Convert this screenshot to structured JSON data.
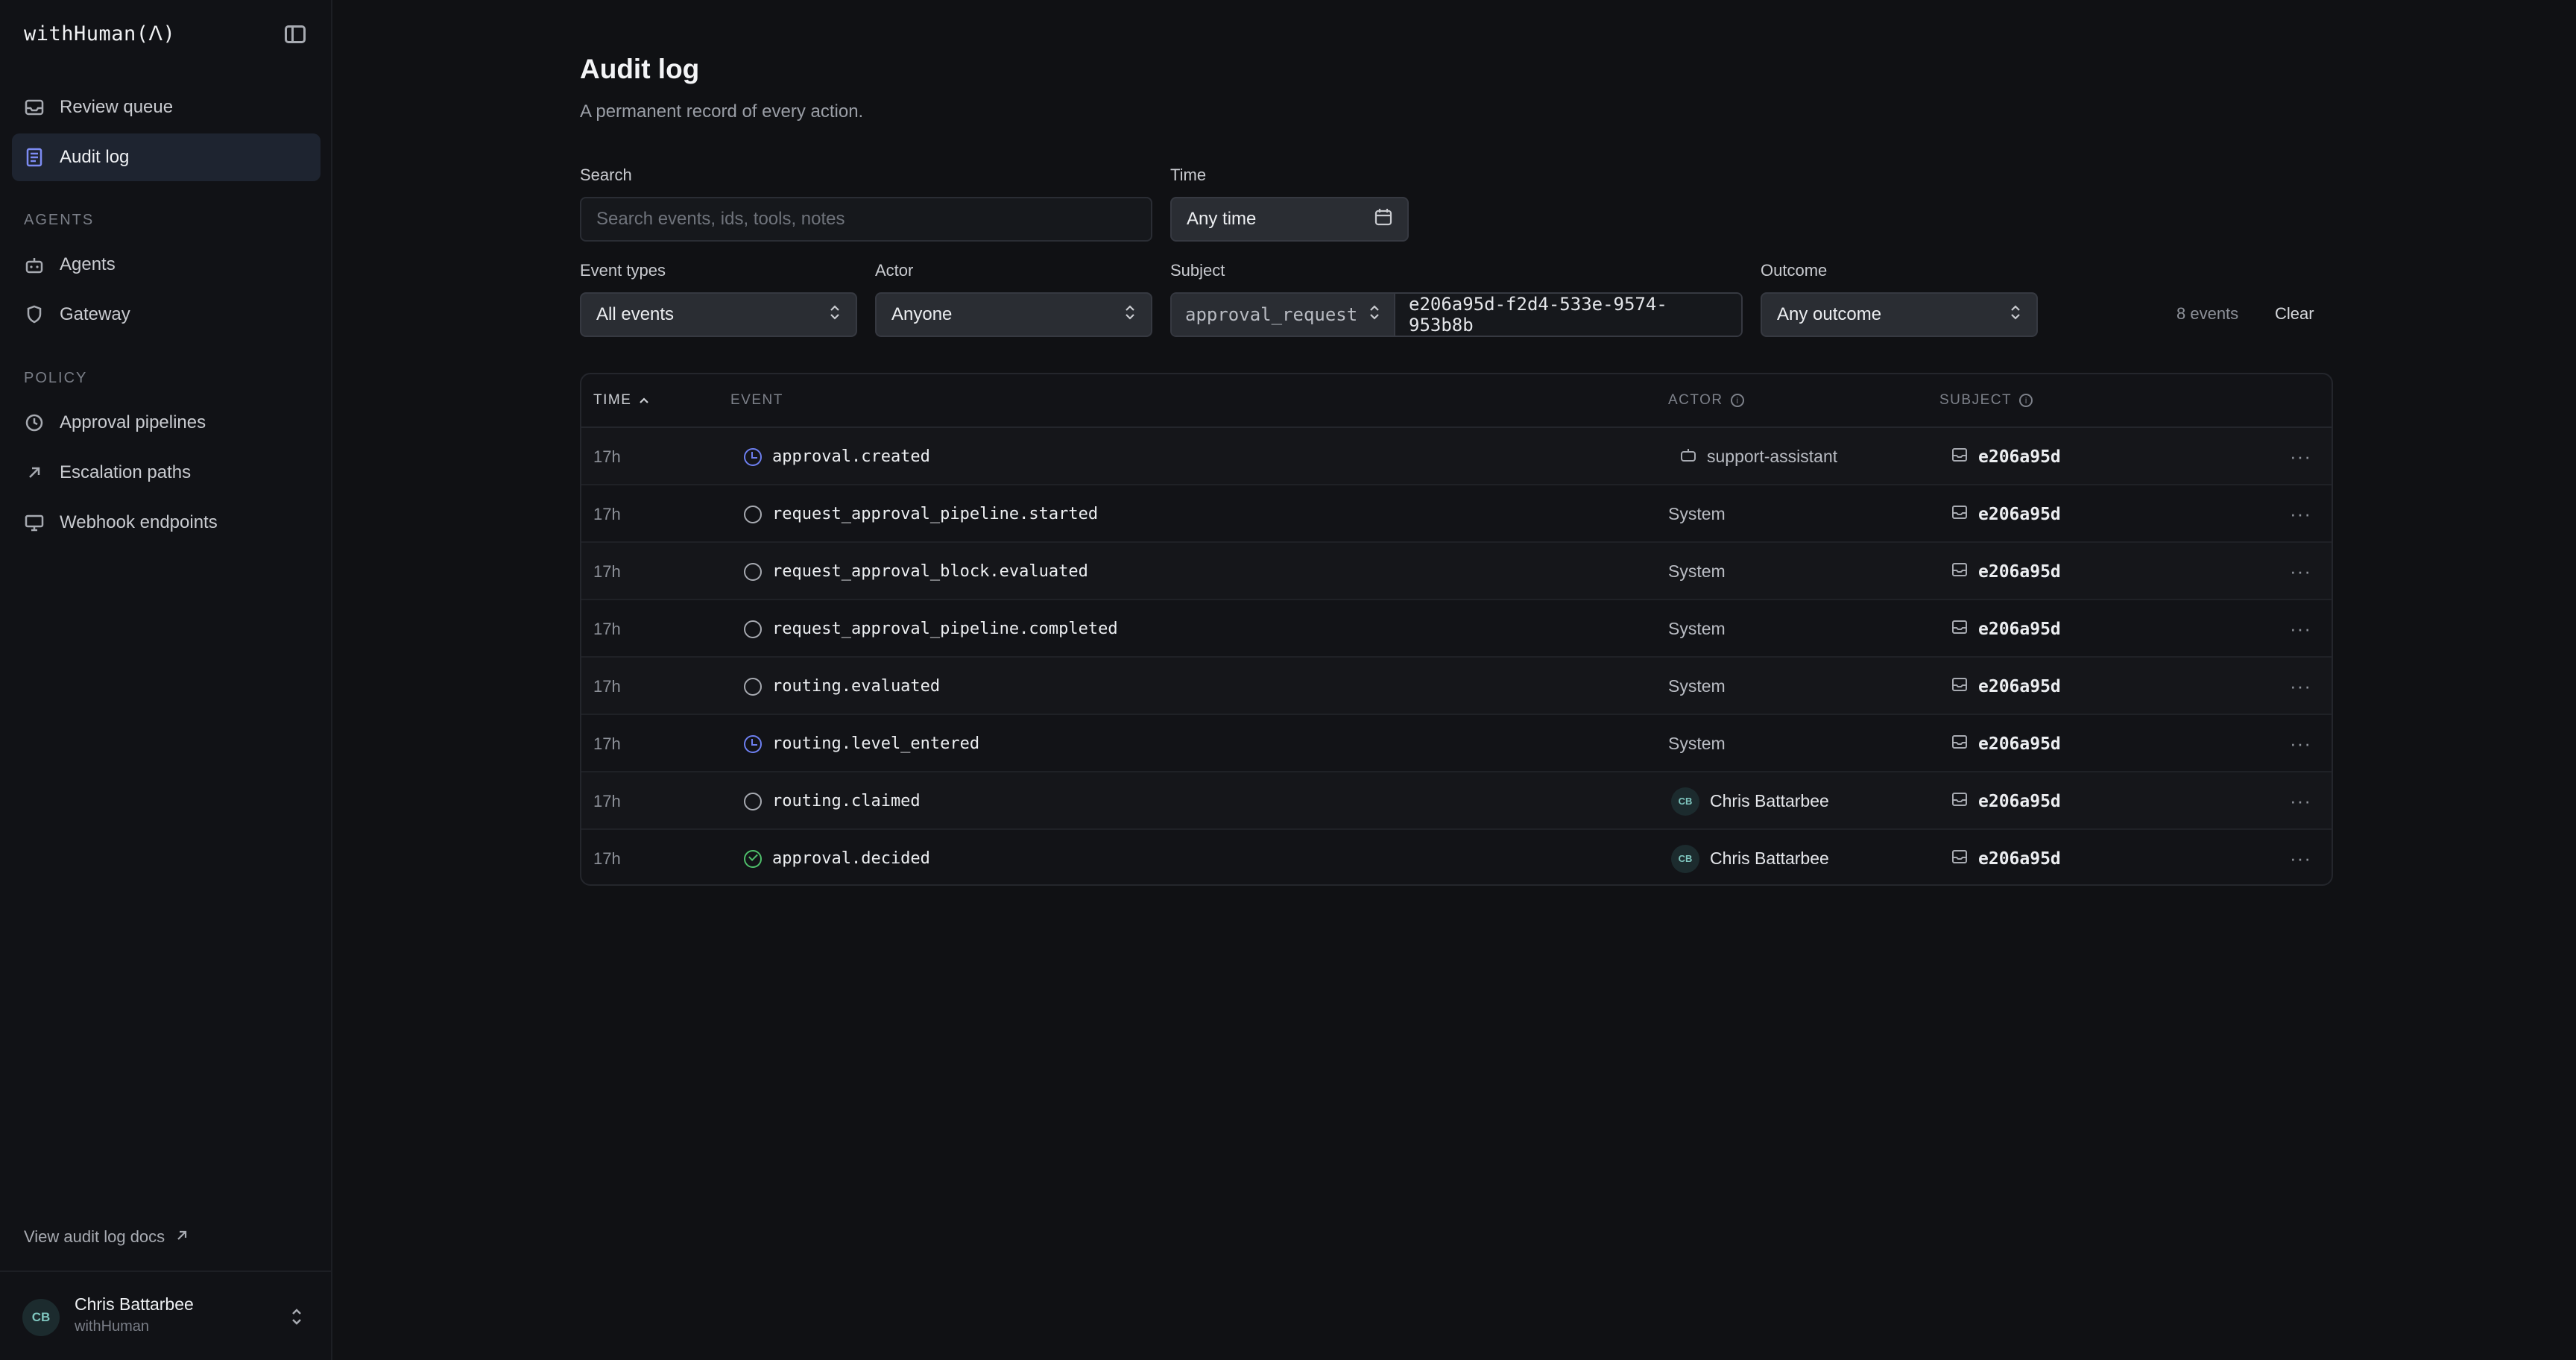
{
  "sidebar": {
    "brand": "withHuman(ᐱ)",
    "items": [
      {
        "label": "Review queue"
      },
      {
        "label": "Audit log"
      }
    ],
    "agents_section": "AGENTS",
    "agents_items": [
      {
        "label": "Agents"
      },
      {
        "label": "Gateway"
      }
    ],
    "policy_section": "POLICY",
    "policy_items": [
      {
        "label": "Approval pipelines"
      },
      {
        "label": "Escalation paths"
      },
      {
        "label": "Webhook endpoints"
      }
    ],
    "docs_link": "View audit log docs",
    "user": {
      "initials": "CB",
      "name": "Chris Battarbee",
      "org": "withHuman"
    }
  },
  "header": {
    "title": "Audit log",
    "subtitle": "A permanent record of every action."
  },
  "filters": {
    "search_label": "Search",
    "search_placeholder": "Search events, ids, tools, notes",
    "time_label": "Time",
    "time_value": "Any time",
    "event_types_label": "Event types",
    "event_types_value": "All events",
    "actor_label": "Actor",
    "actor_value": "Anyone",
    "subject_label": "Subject",
    "subject_type": "approval_request",
    "subject_id": "e206a95d-f2d4-533e-9574-953b8b",
    "outcome_label": "Outcome",
    "outcome_value": "Any outcome",
    "count": "8 events",
    "clear": "Clear"
  },
  "table": {
    "headers": {
      "time": "TIME",
      "event": "EVENT",
      "actor": "ACTOR",
      "subject": "SUBJECT"
    },
    "rows": [
      {
        "time": "17h",
        "event": "approval.created",
        "actor": "support-assistant",
        "subject": "e206a95d"
      },
      {
        "time": "17h",
        "event": "request_approval_pipeline.started",
        "actor": "System",
        "subject": "e206a95d"
      },
      {
        "time": "17h",
        "event": "request_approval_block.evaluated",
        "actor": "System",
        "subject": "e206a95d"
      },
      {
        "time": "17h",
        "event": "request_approval_pipeline.completed",
        "actor": "System",
        "subject": "e206a95d"
      },
      {
        "time": "17h",
        "event": "routing.evaluated",
        "actor": "System",
        "subject": "e206a95d"
      },
      {
        "time": "17h",
        "event": "routing.level_entered",
        "actor": "System",
        "subject": "e206a95d"
      },
      {
        "time": "17h",
        "event": "routing.claimed",
        "actor": "Chris Battarbee",
        "actor_initials": "CB",
        "subject": "e206a95d"
      },
      {
        "time": "17h",
        "event": "approval.decided",
        "actor": "Chris Battarbee",
        "actor_initials": "CB",
        "subject": "e206a95d"
      }
    ],
    "more": "···"
  }
}
